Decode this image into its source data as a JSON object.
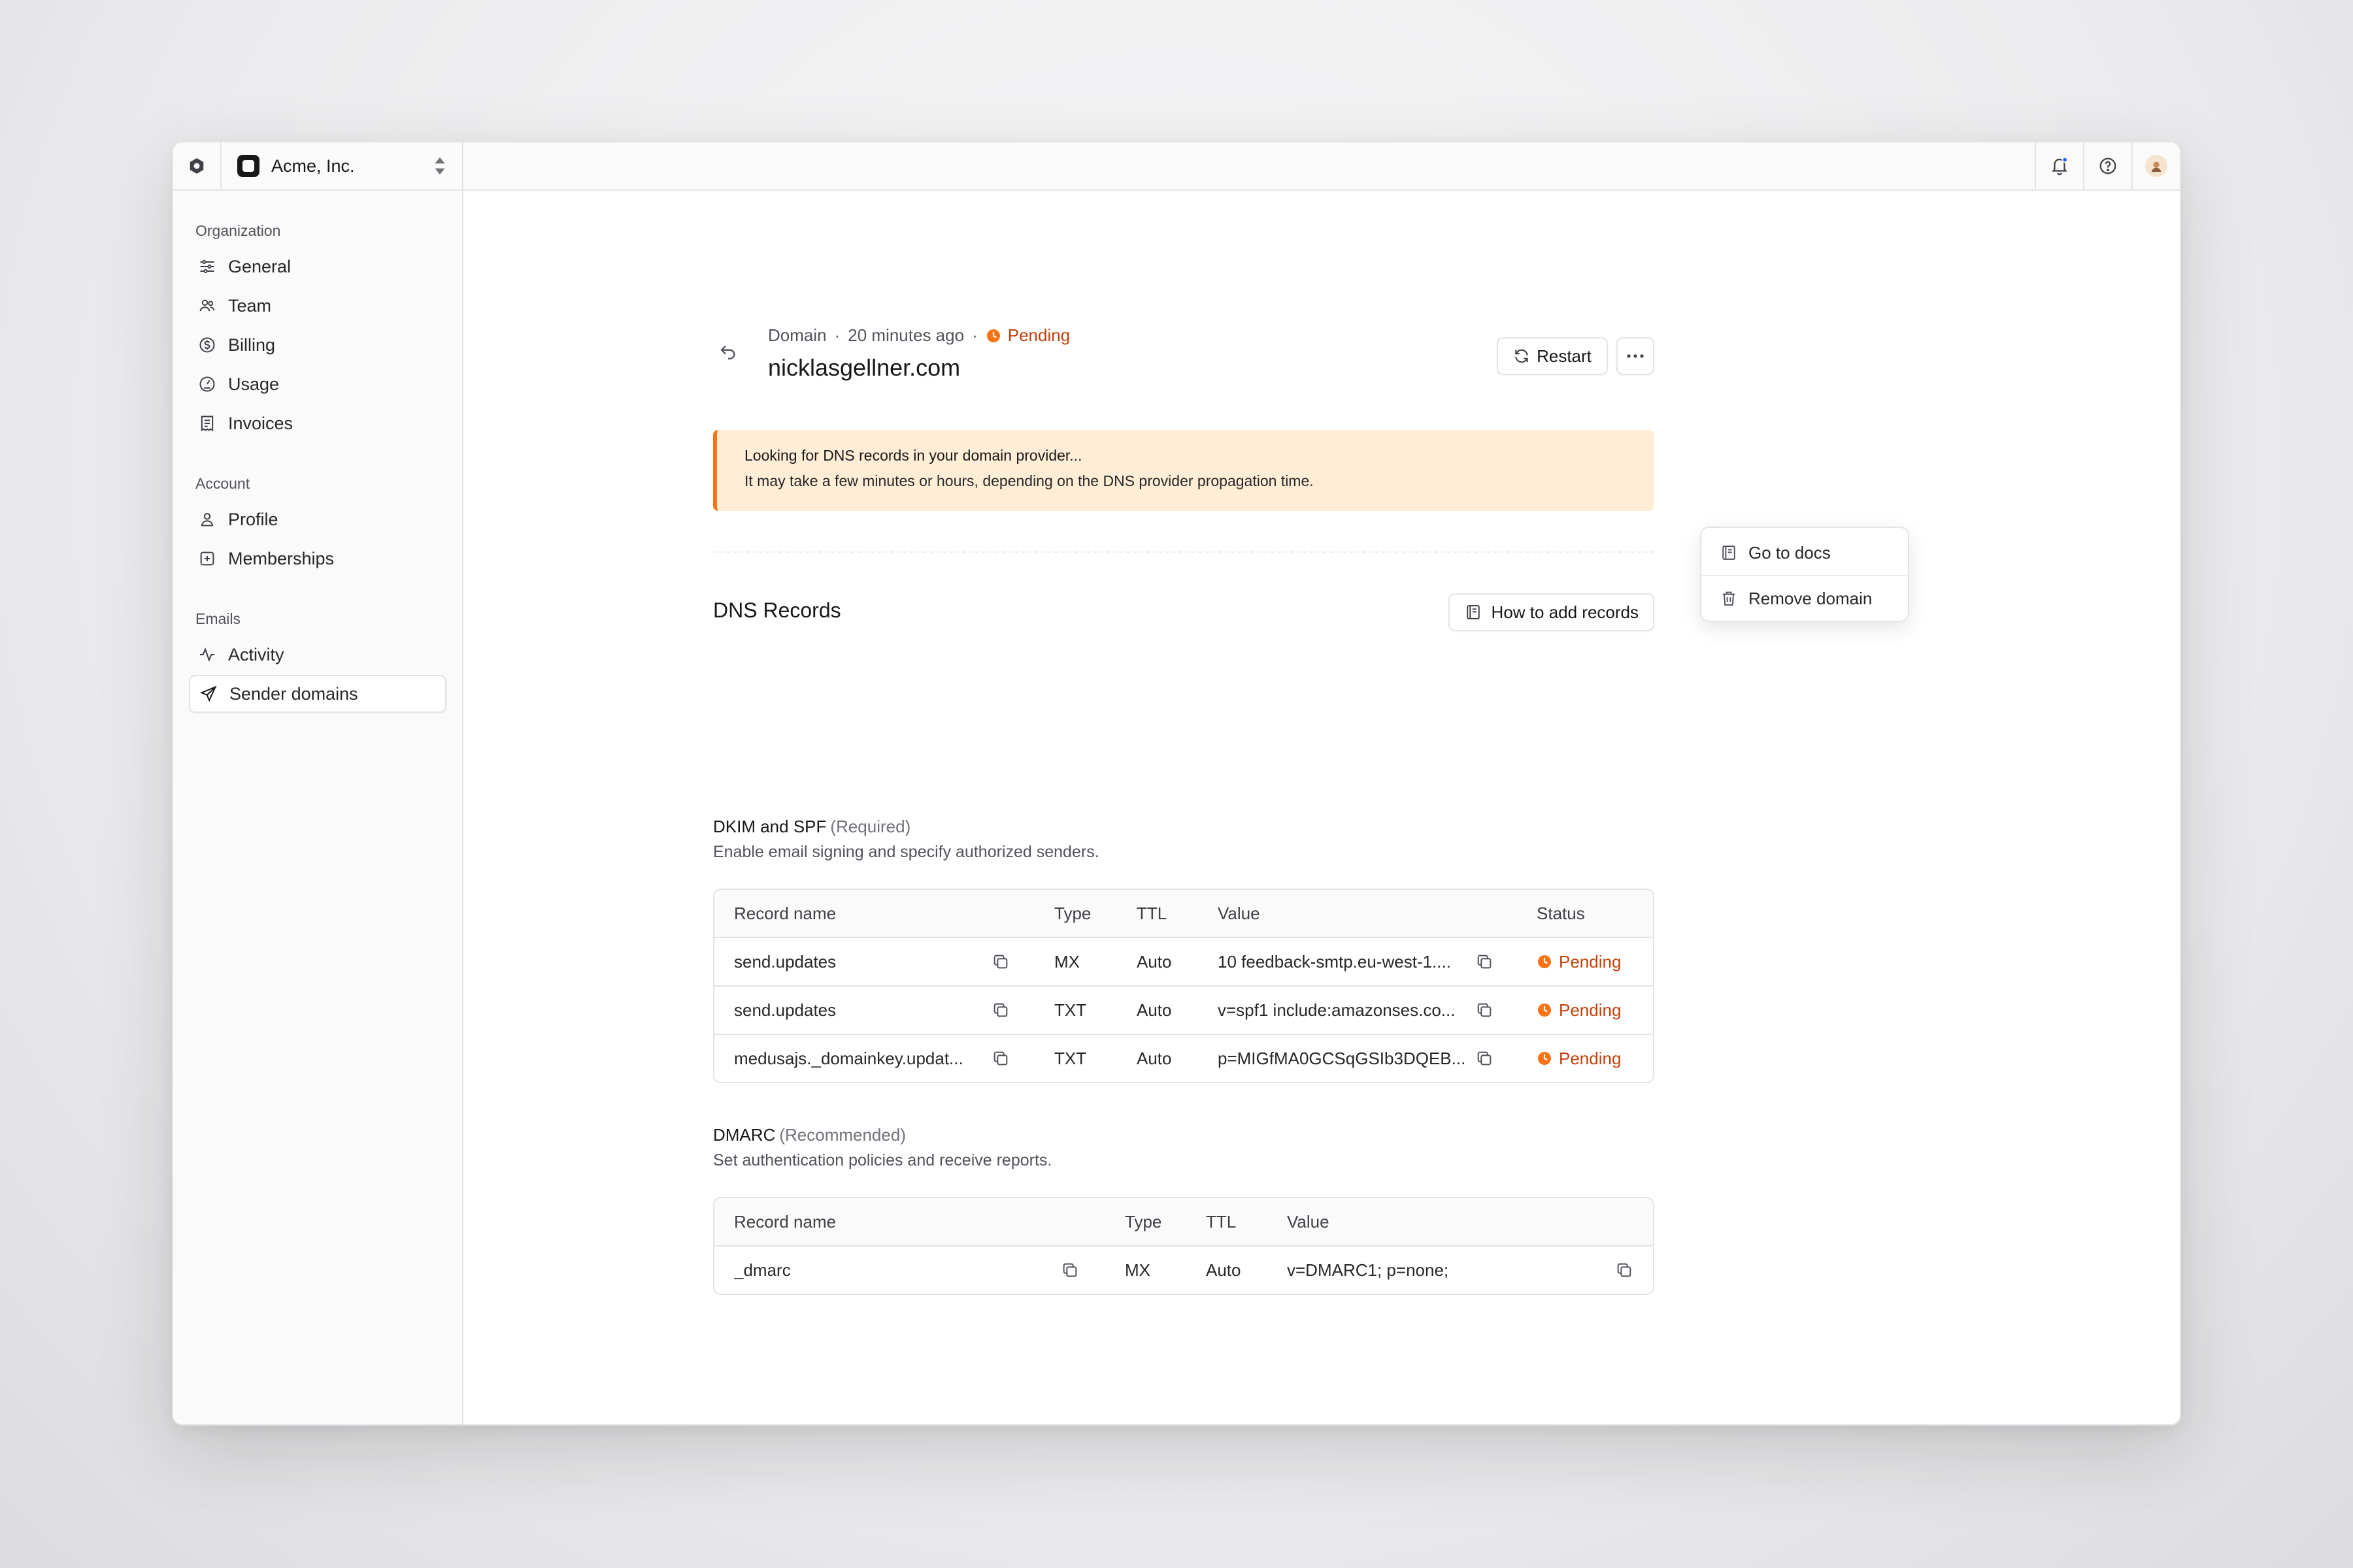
{
  "topbar": {
    "org_name": "Acme, Inc."
  },
  "sidebar": {
    "sections": [
      {
        "title": "Organization",
        "items": [
          {
            "label": "General",
            "icon": "sliders-icon"
          },
          {
            "label": "Team",
            "icon": "users-icon"
          },
          {
            "label": "Billing",
            "icon": "dollar-circle-icon"
          },
          {
            "label": "Usage",
            "icon": "gauge-icon"
          },
          {
            "label": "Invoices",
            "icon": "receipt-icon"
          }
        ]
      },
      {
        "title": "Account",
        "items": [
          {
            "label": "Profile",
            "icon": "user-icon"
          },
          {
            "label": "Memberships",
            "icon": "plus-square-icon"
          }
        ]
      },
      {
        "title": "Emails",
        "items": [
          {
            "label": "Activity",
            "icon": "activity-icon"
          },
          {
            "label": "Sender domains",
            "icon": "send-icon",
            "active": true
          }
        ]
      }
    ]
  },
  "header": {
    "kind": "Domain",
    "time": "20 minutes ago",
    "status": "Pending",
    "domain": "nicklasgellner.com",
    "restart_label": "Restart"
  },
  "menu": {
    "items": [
      "Go to docs",
      "Remove domain"
    ]
  },
  "alert": {
    "title": "Looking for DNS records in your domain provider...",
    "body": "It may take a few minutes or hours, depending on the DNS provider propagation time."
  },
  "dns": {
    "title": "DNS Records",
    "howto_label": "How to add records"
  },
  "dkim": {
    "title": "DKIM and SPF",
    "tag": "(Required)",
    "desc": "Enable email signing and specify authorized senders.",
    "columns": [
      "Record name",
      "Type",
      "TTL",
      "Value",
      "Status"
    ],
    "rows": [
      {
        "name": "send.updates",
        "type": "MX",
        "ttl": "Auto",
        "value": "10 feedback-smtp.eu-west-1....",
        "status": "Pending"
      },
      {
        "name": "send.updates",
        "type": "TXT",
        "ttl": "Auto",
        "value": "v=spf1 include:amazonses.co...",
        "status": "Pending"
      },
      {
        "name": "medusajs._domainkey.updat...",
        "type": "TXT",
        "ttl": "Auto",
        "value": "p=MIGfMA0GCSqGSIb3DQEB...",
        "status": "Pending"
      }
    ]
  },
  "dmarc": {
    "title": "DMARC",
    "tag": "(Recommended)",
    "desc": "Set authentication policies and receive reports.",
    "columns": [
      "Record name",
      "Type",
      "TTL",
      "Value"
    ],
    "rows": [
      {
        "name": "_dmarc",
        "type": "MX",
        "ttl": "Auto",
        "value": "v=DMARC1; p=none;"
      }
    ]
  },
  "colors": {
    "pending": "#c2410c",
    "pending_icon": "#f97316",
    "alert_bg": "#ffedd5",
    "alert_border": "#f97316"
  }
}
